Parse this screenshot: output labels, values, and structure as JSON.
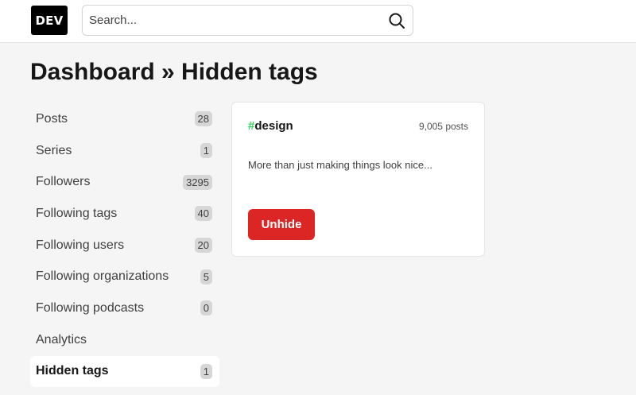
{
  "header": {
    "logo_text": "DEV",
    "search": {
      "placeholder": "Search...",
      "value": ""
    },
    "search_icon": "search-icon"
  },
  "page": {
    "title": "Dashboard » Hidden tags"
  },
  "sidebar": {
    "items": [
      {
        "label": "Posts",
        "count": "28",
        "active": false
      },
      {
        "label": "Series",
        "count": "1",
        "active": false
      },
      {
        "label": "Followers",
        "count": "3295",
        "active": false
      },
      {
        "label": "Following tags",
        "count": "40",
        "active": false
      },
      {
        "label": "Following users",
        "count": "20",
        "active": false
      },
      {
        "label": "Following organizations",
        "count": "5",
        "active": false
      },
      {
        "label": "Following podcasts",
        "count": "0",
        "active": false
      },
      {
        "label": "Analytics",
        "count": null,
        "active": false
      },
      {
        "label": "Hidden tags",
        "count": "1",
        "active": true
      }
    ]
  },
  "tag_card": {
    "hash": "#",
    "name": "design",
    "hash_color": "#34d058",
    "posts": "9,005 posts",
    "description": "More than just making things look nice...",
    "button_label": "Unhide",
    "button_color": "#dc2626"
  }
}
